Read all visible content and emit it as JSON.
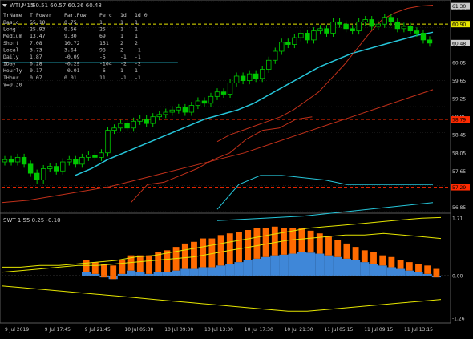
{
  "title_bar": {
    "symbol": "WTI,M15",
    "ohlc": "60.51 60.57 60.36 60.48"
  },
  "info_table": {
    "headers": [
      "TrName",
      "TrPower",
      "PartPow",
      "Perc",
      "1d",
      "1d_0"
    ],
    "rows": [
      [
        "Basic",
        "55.10",
        "0.75",
        "1",
        "1",
        "1"
      ],
      [
        "Long",
        "25.93",
        "6.56",
        "25",
        "1",
        "1"
      ],
      [
        "Medium",
        "13.47",
        "9.30",
        "69",
        "1",
        "1"
      ],
      [
        "Short",
        "7.08",
        "10.72",
        "151",
        "2",
        "2"
      ],
      [
        "Local",
        "3.73",
        "3.64",
        "98",
        "2",
        "-1"
      ],
      [
        "Daily",
        "1.87",
        "-0.09",
        "-5",
        "-1",
        "-1"
      ],
      [
        "IDay",
        "0.28",
        "-0.29",
        "-104",
        "-2",
        "-2"
      ],
      [
        "Hourly",
        "0.17",
        "-0.01",
        "-6",
        "1",
        "1"
      ],
      [
        "IHour",
        "0.07",
        "0.01",
        "11",
        "-1",
        "-1"
      ]
    ],
    "footer": "V=0.30"
  },
  "indicator_title": "SWT 1.55 0.25 -0.10",
  "colors": {
    "background": "#000000",
    "grid": "#2a2a2a",
    "text": "#c8c8c8",
    "candle": "#00c800",
    "cyan": "#26c6da",
    "red": "#c0301a",
    "yellow": "#e6e600",
    "orange": "#ff6a00",
    "hist_blue": "#3f87d8",
    "marker_red": "#ff2a00",
    "marker_yellow": "#e6e600",
    "price_tag": "#cfcfcf"
  },
  "chart_data": [
    {
      "type": "line",
      "title": "WTI,M15",
      "y_ticks": [
        61.25,
        60.65,
        60.05,
        59.45,
        58.85,
        58.25,
        57.65,
        57.05,
        56.45
      ],
      "y_tick_labels": [
        "61.30",
        "60.90",
        "60.48",
        "60.05",
        "59.65",
        "59.25",
        "58.85",
        "58.45",
        "58.05",
        "57.65",
        "57.29",
        "56.85"
      ],
      "y_axis_labels": [
        "61.30",
        "61.25",
        "60.90",
        "60.48",
        "60.05",
        "59.65",
        "59.25",
        "58.85",
        "58.45",
        "58.05",
        "57.65",
        "57.29",
        "56.85"
      ],
      "ylim": [
        56.75,
        61.4
      ],
      "x_ticks": [
        "9 Jul 2019",
        "9 Jul 17:45",
        "9 Jul 21:45",
        "10 Jul 05:30",
        "10 Jul 09:30",
        "10 Jul 13:30",
        "10 Jul 17:30",
        "10 Jul 21:30",
        "11 Jul 05:15",
        "11 Jul 09:15",
        "11 Jul 13:15"
      ],
      "marker_labels": [
        {
          "text": "61.30",
          "y": 61.3,
          "color": "#c8c8c8"
        },
        {
          "text": "60.90",
          "y": 60.9,
          "color": "#e6e600"
        },
        {
          "text": "60.48",
          "y": 60.48,
          "color": "#cfcfcf"
        },
        {
          "text": "58.79",
          "y": 58.79,
          "color": "#ff2a00"
        },
        {
          "text": "57.29",
          "y": 57.29,
          "color": "#ff2a00"
        }
      ],
      "horizontal_lines": [
        {
          "y": 60.9,
          "color": "#e6e600",
          "style": "dashed"
        },
        {
          "y": 58.79,
          "color": "#ff2a00",
          "style": "dashed"
        },
        {
          "y": 57.29,
          "color": "#ff2a00",
          "style": "dashed"
        },
        {
          "y": 60.05,
          "color": "#26c6da",
          "style": "solid",
          "x_to_index": 26
        }
      ],
      "candles_close": [
        57.9,
        57.85,
        57.95,
        57.8,
        57.6,
        57.45,
        57.7,
        57.75,
        57.65,
        57.85,
        57.9,
        57.8,
        57.95,
        58.0,
        57.95,
        58.05,
        58.55,
        58.6,
        58.7,
        58.6,
        58.75,
        58.8,
        58.7,
        58.85,
        58.9,
        58.95,
        59.0,
        59.05,
        58.95,
        59.1,
        59.2,
        59.15,
        59.3,
        59.4,
        59.35,
        59.6,
        59.75,
        59.65,
        59.8,
        59.7,
        59.9,
        60.1,
        60.3,
        60.5,
        60.45,
        60.6,
        60.7,
        60.55,
        60.75,
        60.8,
        60.7,
        60.95,
        60.9,
        60.8,
        60.75,
        60.95,
        61.0,
        60.85,
        60.9,
        61.05,
        60.95,
        60.8,
        60.85,
        60.75,
        60.7,
        60.55,
        60.48
      ],
      "series": [
        {
          "color": "#26c6da",
          "values": [
            57.55,
            57.7,
            57.9,
            58.05,
            58.2,
            58.35,
            58.5,
            58.65,
            58.8,
            58.9,
            59.0,
            59.15,
            59.35,
            59.55,
            59.75,
            59.95,
            60.1,
            60.25,
            60.35,
            60.45,
            60.55,
            60.65,
            60.72
          ]
        },
        {
          "color": "#c0301a",
          "values": [
            58.3,
            58.45,
            58.55,
            58.65,
            58.75,
            58.85,
            59.0,
            59.2,
            59.4,
            59.7,
            60.0,
            60.35,
            60.7,
            61.0,
            61.15,
            61.25,
            61.3,
            61.32
          ]
        },
        {
          "color": "#c0301a",
          "values": [
            56.95,
            57.0,
            57.1,
            57.2,
            57.3,
            57.45,
            57.6,
            57.75,
            57.9,
            58.05,
            58.25,
            58.45,
            58.65,
            58.85,
            59.05,
            59.25,
            59.45
          ]
        },
        {
          "color": "#c0301a",
          "values": [
            56.95,
            57.35,
            57.4,
            57.55,
            57.7,
            57.9,
            58.05,
            58.35,
            58.55,
            58.6,
            58.79,
            58.85
          ]
        },
        {
          "color": "#26c6da",
          "values": [
            56.8,
            57.35,
            57.55,
            57.55,
            57.5,
            57.45,
            57.35,
            57.35,
            57.35,
            57.35,
            57.35
          ]
        },
        {
          "color": "#26c6da",
          "values": [
            56.55,
            56.6,
            56.65,
            56.75,
            56.85,
            56.95
          ]
        }
      ]
    },
    {
      "type": "area",
      "title": "SWT 1.55 0.25 -0.10",
      "y_tick_labels": [
        "1.71",
        "0.00",
        "-1.26"
      ],
      "ylim": [
        -1.35,
        1.8
      ],
      "series": [
        {
          "name": "blue",
          "color": "#3f87d8",
          "values": [
            0.1,
            0.05,
            -0.05,
            -0.1,
            0.05,
            0.15,
            0.1,
            0.05,
            0.1,
            0.1,
            0.15,
            0.2,
            0.2,
            0.25,
            0.25,
            0.3,
            0.35,
            0.4,
            0.45,
            0.5,
            0.55,
            0.6,
            0.62,
            0.65,
            0.7,
            0.68,
            0.65,
            0.6,
            0.55,
            0.5,
            0.45,
            0.4,
            0.35,
            0.3,
            0.25,
            0.2,
            0.15,
            0.1,
            0.05,
            -0.05
          ]
        },
        {
          "name": "orange",
          "color": "#ff6a00",
          "values": [
            0.05,
            0.05,
            0.1,
            0.1,
            0.1,
            0.15,
            0.2,
            0.25,
            0.3,
            0.35,
            0.4,
            0.45,
            0.5,
            0.55,
            0.55,
            0.6,
            0.6,
            0.6,
            0.6,
            0.6,
            0.55,
            0.55,
            0.5,
            0.45,
            0.4,
            0.35,
            0.3,
            0.25,
            0.2,
            0.15,
            0.1,
            0.05,
            0.05,
            0.0,
            0.0,
            -0.05,
            -0.05,
            -0.05,
            -0.05,
            -0.05
          ]
        },
        {
          "name": "upper-yellow",
          "color": "#e6e600",
          "values": [
            0.25,
            0.25,
            0.3,
            0.3,
            0.35,
            0.4,
            0.45,
            0.55,
            0.6,
            0.7,
            0.8,
            0.9,
            1.0,
            1.1,
            1.2,
            1.3,
            1.4,
            1.45,
            1.5,
            1.55,
            1.6,
            1.65,
            1.7,
            1.72
          ]
        },
        {
          "name": "mid-yellow",
          "color": "#e6e600",
          "values": [
            0.1,
            0.15,
            0.2,
            0.25,
            0.3,
            0.3,
            0.35,
            0.4,
            0.45,
            0.5,
            0.55,
            0.65,
            0.75,
            0.85,
            0.95,
            1.05,
            1.1,
            1.15,
            1.2,
            1.2,
            1.25,
            1.2,
            1.15,
            1.1
          ]
        },
        {
          "name": "lower-yellow",
          "color": "#e6e600",
          "values": [
            -0.3,
            -0.35,
            -0.4,
            -0.45,
            -0.5,
            -0.55,
            -0.6,
            -0.65,
            -0.7,
            -0.75,
            -0.8,
            -0.85,
            -0.9,
            -0.95,
            -1.0,
            -1.05,
            -1.05,
            -1.0,
            -0.95,
            -0.9,
            -0.85,
            -0.8,
            -0.75,
            -0.7
          ]
        }
      ]
    }
  ]
}
